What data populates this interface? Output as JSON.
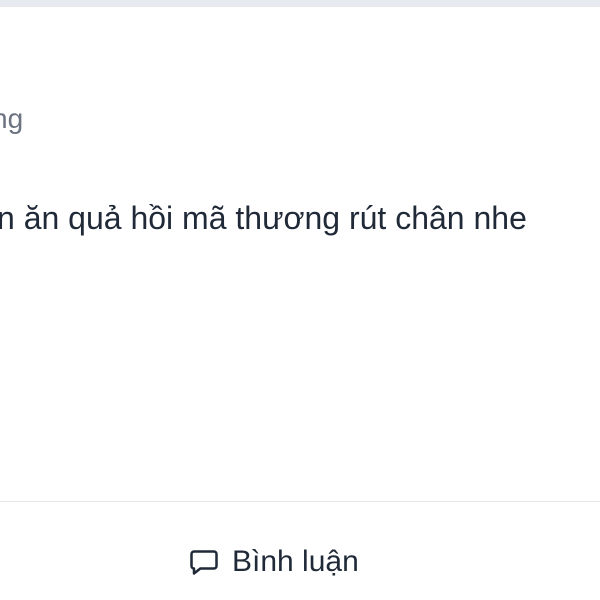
{
  "post": {
    "meta_text": "ng",
    "body_text": "n ăn quả hồi mã thương rút chân nhe"
  },
  "actions": {
    "comment_label": "Bình luận",
    "comment_icon": "comment-bubble-icon"
  },
  "colors": {
    "background": "#ffffff",
    "text": "#1f2937",
    "muted_text": "#6b7280",
    "divider": "#e5e7eb"
  }
}
